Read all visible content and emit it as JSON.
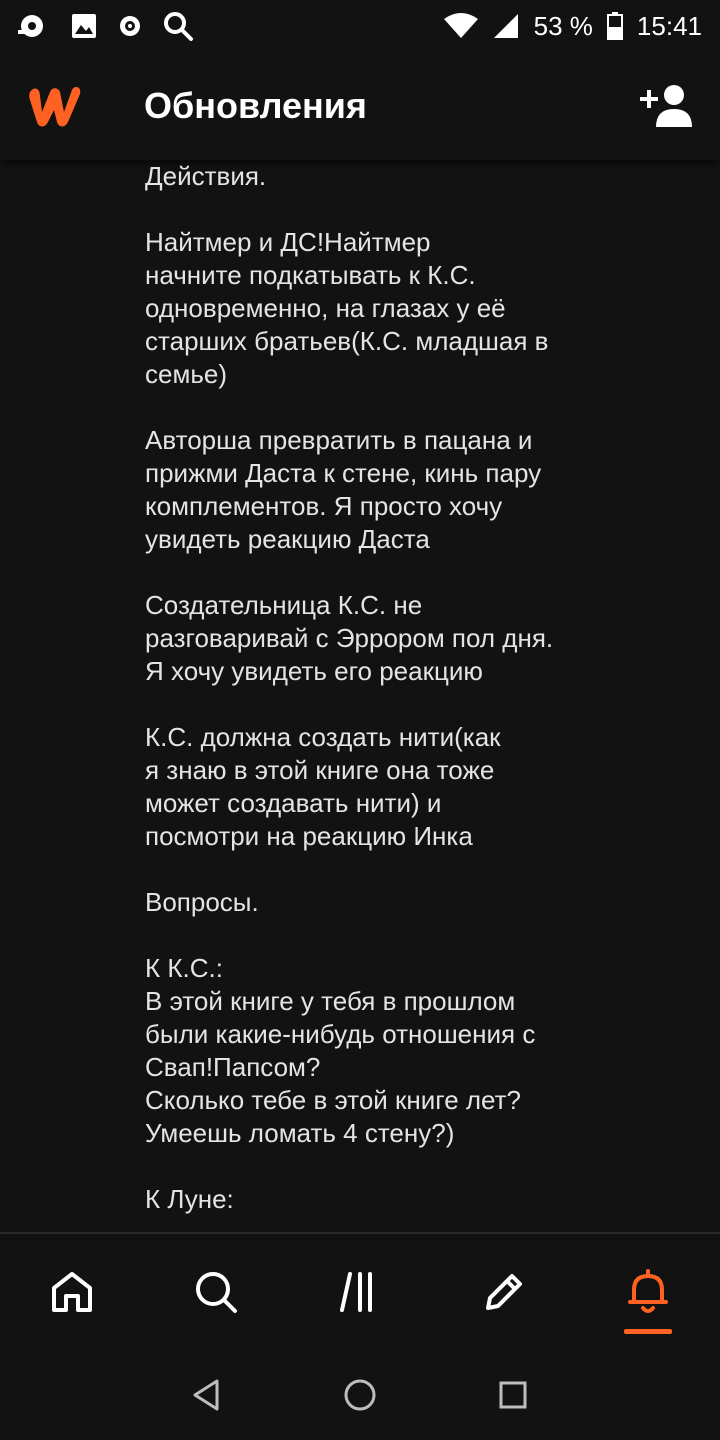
{
  "status_bar": {
    "battery": "53 %",
    "time": "15:41",
    "icons": [
      "cast-icon",
      "image-icon",
      "record-icon",
      "search-icon",
      "wifi-icon",
      "signal-icon",
      "battery-icon"
    ]
  },
  "app_bar": {
    "title": "Обновления",
    "logo": "wattpad-logo",
    "action_icon": "add-user-icon"
  },
  "content": {
    "paragraphs": [
      "Действия.",
      "Найтмер и ДС!Найтмер\nначните подкатывать к К.С.\nодновременно, на глазах у её\nстарших братьев(К.С. младшая в\nсемье)",
      "Авторша превратить в пацана и\nприжми Даста к стене, кинь пару\nкомплементов. Я просто хочу\nувидеть реакцию Даста",
      "Создательница К.С. не\nразговаривай с Эррором пол дня.\nЯ хочу увидеть его реакцию",
      "К.С. должна создать нити(как\nя знаю в этой книге она тоже\nможет создавать нити) и\nпосмотри на реакцию Инка",
      "Вопросы.",
      "К К.С.:\nВ этой книге у тебя в прошлом\nбыли какие-нибудь отношения с\nСвап!Папсом?\nСколько тебе в этой книге лет?\nУмеешь ломать 4 стену?)",
      "К Луне:"
    ]
  },
  "bottom_nav": {
    "items": [
      {
        "icon": "home-icon",
        "active": false
      },
      {
        "icon": "search-icon",
        "active": false
      },
      {
        "icon": "library-icon",
        "active": false
      },
      {
        "icon": "write-icon",
        "active": false
      },
      {
        "icon": "bell-icon",
        "active": true
      }
    ],
    "accent_color": "#ff6122"
  },
  "system_nav": [
    "back-icon",
    "home-circle-icon",
    "recents-icon"
  ]
}
